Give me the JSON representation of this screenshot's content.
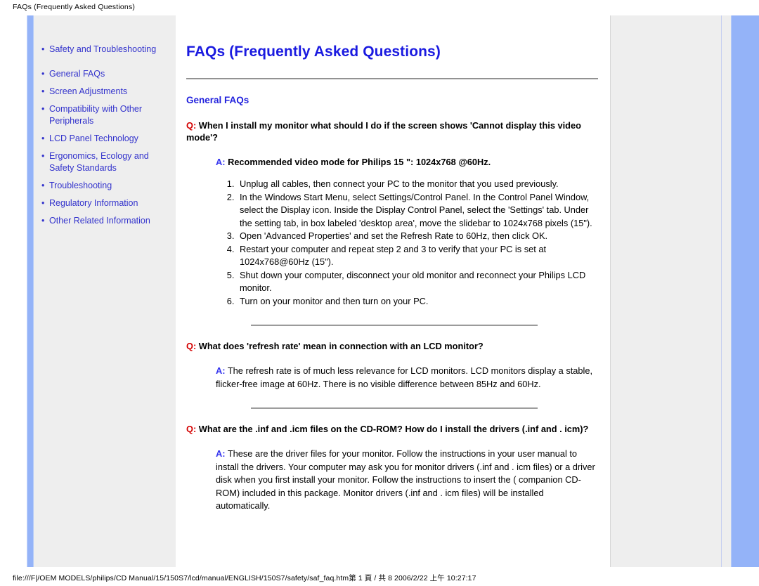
{
  "print": {
    "header": "FAQs (Frequently Asked Questions)",
    "footer": "file:///F|/OEM MODELS/philips/CD Manual/15/150S7/lcd/manual/ENGLISH/150S7/safety/saf_faq.htm第 1 頁 / 共 8 2006/2/22 上午 10:27:17"
  },
  "colors": {
    "link_blue": "#3333cc",
    "title_blue": "#1a1ae0",
    "question_red": "#d40000",
    "answer_blue": "#3333ee",
    "accent_bar": "#94b3f8",
    "panel_gray": "#eeeeee"
  },
  "sidebar": {
    "bullet": "•",
    "items": [
      {
        "label": "Safety and Troubleshooting"
      },
      {
        "label": "General FAQs"
      },
      {
        "label": "Screen Adjustments"
      },
      {
        "label": "Compatibility with Other Peripherals"
      },
      {
        "label": "LCD Panel Technology"
      },
      {
        "label": "Ergonomics, Ecology and Safety Standards"
      },
      {
        "label": "Troubleshooting"
      },
      {
        "label": "Regulatory Information"
      },
      {
        "label": "Other Related Information"
      }
    ]
  },
  "main": {
    "title": "FAQs (Frequently Asked Questions)",
    "section_heading": "General FAQs",
    "q_prefix": "Q:",
    "a_prefix": "A:",
    "qa": [
      {
        "question": "When I install my monitor what should I do if the screen shows 'Cannot display this video mode'?",
        "answer_head": "Recommended video mode for Philips 15 \": 1024x768 @60Hz.",
        "steps": [
          "Unplug all cables, then connect your PC to the monitor that you used previously.",
          "In the Windows Start Menu, select Settings/Control Panel. In the Control Panel Window, select the Display icon. Inside the Display Control Panel, select the 'Settings' tab. Under the setting tab, in box labeled 'desktop area', move the slidebar to 1024x768 pixels (15\").",
          "Open 'Advanced Properties' and set the Refresh Rate to 60Hz, then click OK.",
          "Restart your computer and repeat step 2 and 3 to verify that your PC is set at 1024x768@60Hz (15\").",
          "Shut down your computer, disconnect your old monitor and reconnect your Philips LCD monitor.",
          "Turn on your monitor and then turn on your PC."
        ]
      },
      {
        "question": "What does 'refresh rate' mean in connection with an LCD monitor?",
        "answer_body": "The refresh rate is of much less relevance for LCD monitors. LCD monitors display a stable, flicker-free image at 60Hz. There is no visible difference between 85Hz and 60Hz."
      },
      {
        "question": "What are the .inf and .icm files on the CD-ROM? How do I install the drivers (.inf and . icm)?",
        "answer_body": "These are the driver files for your monitor. Follow the instructions in your user manual to install the drivers. Your computer may ask you for monitor drivers (.inf and . icm files) or a driver disk when you first install your monitor. Follow the instructions to insert the ( companion CD-ROM) included in this package. Monitor drivers (.inf and . icm files) will be installed automatically."
      }
    ]
  }
}
